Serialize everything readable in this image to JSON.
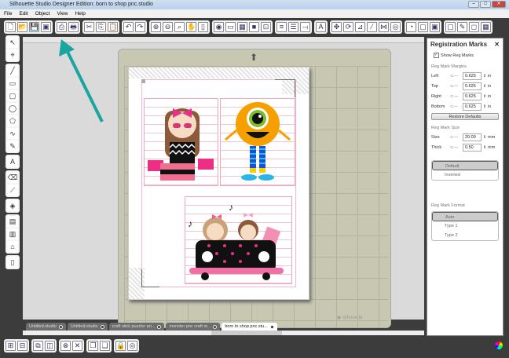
{
  "window": {
    "title": "Silhouette Studio Designer Edition: born to shop pnc.studio"
  },
  "menu": [
    "File",
    "Edit",
    "Object",
    "View",
    "Help"
  ],
  "toolbar": [
    [
      "new-document",
      "open",
      "save",
      "save-to-library"
    ],
    [
      "send-to-silhouette",
      "print"
    ],
    [
      "cut",
      "copy",
      "paste"
    ],
    [
      "undo",
      "redo"
    ],
    [
      "zoom-in",
      "zoom-out",
      "zoom-selection",
      "pan",
      "fit-page"
    ],
    [
      "fill",
      "line-color",
      "gradient",
      "pattern",
      "registration"
    ],
    [
      "line-style",
      "alignment",
      "knife"
    ],
    [
      "text"
    ],
    [
      "transform",
      "rotate",
      "scale",
      "edit-points",
      "mirror",
      "offset"
    ],
    [
      "library",
      "page-setup",
      "cut-settings"
    ],
    [
      "trace",
      "pencil",
      "panel-toggle",
      "grid"
    ]
  ],
  "toolbar_glyphs": {
    "new-document": "🗋",
    "open": "📂",
    "save": "💾",
    "save-to-library": "▣",
    "send-to-silhouette": "⎙",
    "print": "🖶",
    "cut": "✂",
    "copy": "⎘",
    "paste": "📋",
    "undo": "↶",
    "redo": "↷",
    "zoom-in": "⊕",
    "zoom-out": "⊖",
    "zoom-selection": "⌕",
    "pan": "✋",
    "fit-page": "▯",
    "fill": "◉",
    "line-color": "▭",
    "gradient": "▦",
    "pattern": "■",
    "registration": "⊡",
    "line-style": "≡",
    "alignment": "☰",
    "knife": "⟞",
    "text": "A",
    "transform": "✥",
    "rotate": "⟳",
    "scale": "⊿",
    "edit-points": "⁄",
    "mirror": "⋈",
    "offset": "◎",
    "library": "◔",
    "page-setup": "▢",
    "cut-settings": "▣",
    "trace": "▢",
    "pencil": "✎",
    "panel-toggle": "◻",
    "grid": "▦"
  },
  "left_tools": [
    [
      "select",
      "point-edit"
    ],
    [
      "line",
      "rectangle",
      "rounded-rectangle",
      "ellipse",
      "polygon",
      "curve",
      "freehand"
    ],
    [
      "text-tool"
    ],
    [
      "eraser",
      "knife-tool"
    ],
    [
      "fill-bucket"
    ],
    [
      "design-page",
      "library-page",
      "store"
    ],
    [
      "expand"
    ]
  ],
  "left_glyphs": {
    "select": "↖",
    "point-edit": "⌖",
    "line": "╱",
    "rectangle": "▭",
    "rounded-rectangle": "▢",
    "ellipse": "◯",
    "polygon": "⬠",
    "curve": "∿",
    "freehand": "✎",
    "text-tool": "A",
    "eraser": "⌫",
    "knife-tool": "⟋",
    "fill-bucket": "◈",
    "design-page": "▤",
    "library-page": "▥",
    "store": "⌂",
    "expand": "▯"
  },
  "tabs": [
    {
      "label": "Untitled.studio",
      "active": false
    },
    {
      "label": "Untitled.studio",
      "active": false
    },
    {
      "label": "craft stick puzzler pri...",
      "active": false
    },
    {
      "label": "monster pnc craft st...",
      "active": false
    },
    {
      "label": "born to shop pnc.stu...",
      "active": true
    }
  ],
  "bottom_tools": [
    [
      "group",
      "ungroup"
    ],
    [
      "compound",
      "release-compound"
    ],
    [
      "weld",
      "delete"
    ],
    [
      "duplicate",
      "mirror-copy"
    ],
    [
      "lock",
      "offset-copy"
    ]
  ],
  "bottom_glyphs": {
    "group": "⊞",
    "ungroup": "⊟",
    "compound": "⧉",
    "release-compound": "◫",
    "weld": "⊗",
    "delete": "✕",
    "duplicate": "❐",
    "mirror-copy": "❏",
    "lock": "🔒",
    "offset-copy": "◎"
  },
  "panel": {
    "title": "Registration Marks",
    "close": "✕",
    "show_reg_marks": {
      "label": "Show Reg Marks",
      "checked": true
    },
    "margins_header": "Reg Mark Margins",
    "margins": [
      {
        "label": "Left",
        "value": "0.625",
        "unit": "in"
      },
      {
        "label": "Top",
        "value": "0.625",
        "unit": "in"
      },
      {
        "label": "Right",
        "value": "0.625",
        "unit": "in"
      },
      {
        "label": "Bottom",
        "value": "0.625",
        "unit": "in"
      }
    ],
    "restore": "Restore Defaults",
    "size_header": "Reg Mark Size",
    "size": [
      {
        "label": "Size",
        "value": "20.00",
        "unit": "mm"
      },
      {
        "label": "Thick",
        "value": "0.50",
        "unit": "mm"
      }
    ],
    "style_options": [
      {
        "label": "Default",
        "selected": true
      },
      {
        "label": "Inverted",
        "selected": false
      }
    ],
    "format_header": "Reg Mark Format",
    "format_options": [
      {
        "label": "Auto",
        "selected": true
      },
      {
        "label": "Type 1",
        "selected": false
      },
      {
        "label": "Type 2",
        "selected": false
      }
    ]
  },
  "mat_brand": "silhouette",
  "colors": {
    "annotation_arrow": "#1aa5a0",
    "mat": "#c7c7b2",
    "reg_line": "#f4b6c6"
  }
}
